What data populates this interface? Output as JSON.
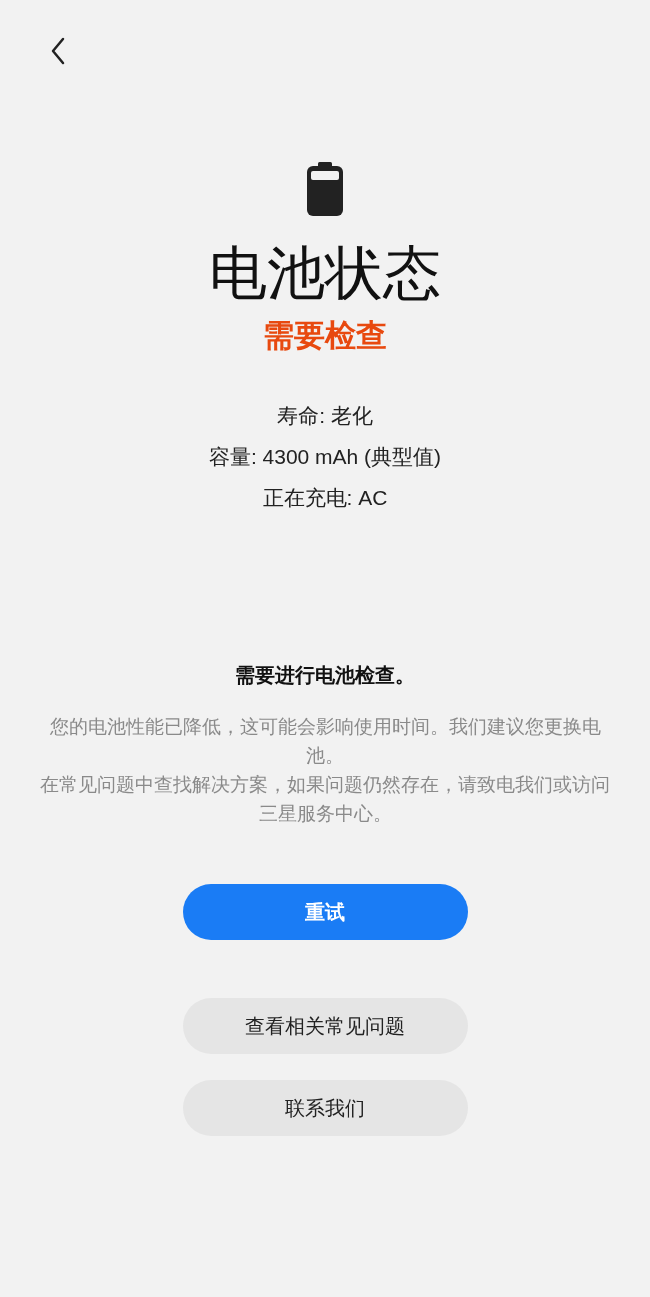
{
  "title": "电池状态",
  "status": "需要检查",
  "details": [
    "寿命: 老化",
    "容量: 4300 mAh (典型值)",
    "正在充电: AC"
  ],
  "message_heading": "需要进行电池检查。",
  "message_paragraphs": [
    "您的电池性能已降低，这可能会影响使用时间。我们建议您更换电池。",
    "在常见问题中查找解决方案，如果问题仍然存在，请致电我们或访问三星服务中心。"
  ],
  "buttons": [
    {
      "label": "重试",
      "kind": "primary"
    },
    {
      "label": "查看相关常见问题",
      "kind": "secondary"
    },
    {
      "label": "联系我们",
      "kind": "secondary"
    }
  ]
}
